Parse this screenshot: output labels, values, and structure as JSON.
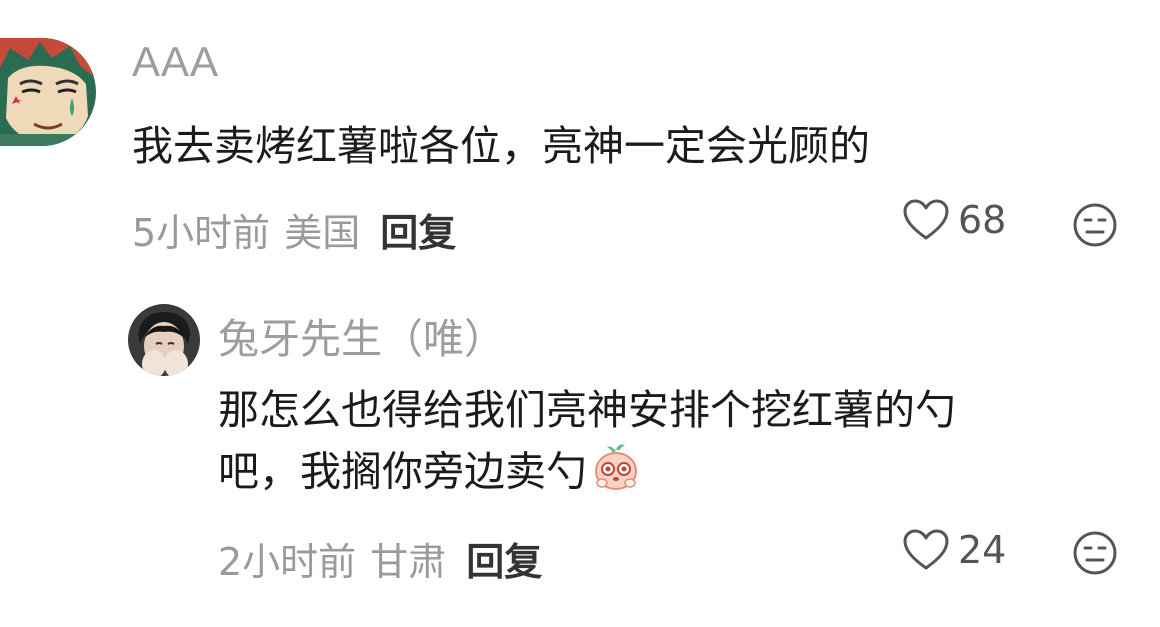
{
  "comments": [
    {
      "username": "AAA",
      "text": "我去卖烤红薯啦各位，亮神一定会光顾的",
      "time": "5小时前",
      "location": "美国",
      "reply_label": "回复",
      "likes": "68",
      "avatar_icon": "anime-character-avatar"
    }
  ],
  "replies": [
    {
      "username": "兔牙先生（唯）",
      "text_line1": "那怎么也得给我们亮神安排个挖红薯的勺",
      "text_line2": "吧，我搁你旁边卖勺",
      "time": "2小时前",
      "location": "甘肃",
      "reply_label": "回复",
      "likes": "24",
      "avatar_icon": "person-photo-avatar",
      "emoji_icon": "peach-face-emoji"
    }
  ],
  "colors": {
    "username": "#9d9d9d",
    "text": "#1b1b1b",
    "meta": "#9a9a9a",
    "reply": "#333333"
  }
}
